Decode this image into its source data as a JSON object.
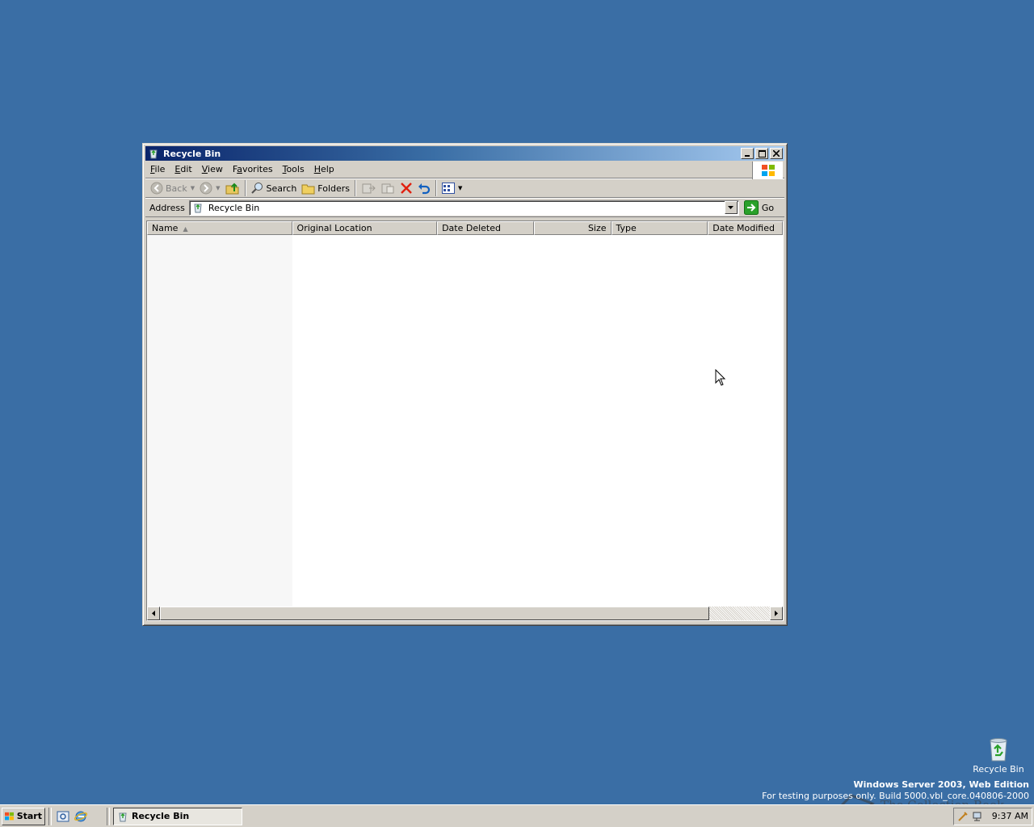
{
  "window": {
    "title": "Recycle Bin",
    "menu": [
      {
        "pre": "",
        "key": "F",
        "post": "ile"
      },
      {
        "pre": "",
        "key": "E",
        "post": "dit"
      },
      {
        "pre": "",
        "key": "V",
        "post": "iew"
      },
      {
        "pre": "F",
        "key": "a",
        "post": "vorites"
      },
      {
        "pre": "",
        "key": "T",
        "post": "ools"
      },
      {
        "pre": "",
        "key": "H",
        "post": "elp"
      }
    ],
    "toolbar": {
      "back": "Back",
      "search": "Search",
      "folders": "Folders"
    },
    "address": {
      "label": "Address",
      "value": "Recycle Bin",
      "go": "Go"
    },
    "columns": [
      {
        "label": "Name"
      },
      {
        "label": "Original Location"
      },
      {
        "label": "Date Deleted"
      },
      {
        "label": "Size"
      },
      {
        "label": "Type"
      },
      {
        "label": "Date Modified"
      }
    ]
  },
  "desktop": {
    "icon_label": "Recycle Bin",
    "edition": "Windows Server 2003, Web Edition",
    "build": "For testing purposes only. Build 5000.vbl_core.040806-2000",
    "brand": "The Collection Book"
  },
  "taskbar": {
    "start": "Start",
    "task": "Recycle Bin",
    "clock": "9:37 AM"
  },
  "colors": {
    "desktop": "#3a6ea5",
    "title_start": "#0a246a",
    "title_end": "#a6caf0",
    "face": "#d4d0c8"
  }
}
